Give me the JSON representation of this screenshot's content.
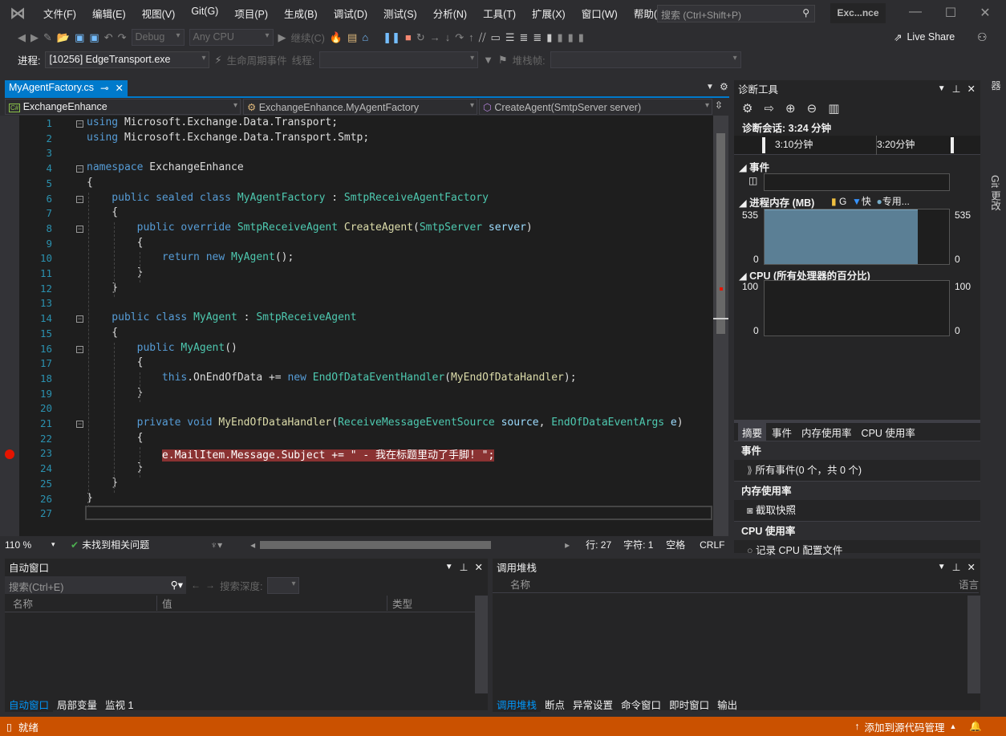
{
  "menu": {
    "items": [
      "文件(F)",
      "编辑(E)",
      "视图(V)",
      "Git(G)",
      "项目(P)",
      "生成(B)",
      "调试(D)",
      "测试(S)",
      "分析(N)",
      "工具(T)",
      "扩展(X)",
      "窗口(W)",
      "帮助(H)"
    ],
    "search_placeholder": "搜索 (Ctrl+Shift+P)",
    "window_title": "Exc...nce"
  },
  "toolbar": {
    "config": "Debug",
    "platform": "Any CPU",
    "continue": "继续(C)",
    "live_share": "Live Share"
  },
  "toolbar2": {
    "process_label": "进程:",
    "process": "[10256] EdgeTransport.exe",
    "lifecycle": "生命周期事件",
    "thread_label": "线程:",
    "stackframe_label": "堆栈帧:"
  },
  "editor": {
    "tab": "MyAgentFactory.cs",
    "nav_project": "ExchangeEnhance",
    "nav_class": "ExchangeEnhance.MyAgentFactory",
    "nav_member": "CreateAgent(SmtpServer server)",
    "lines": [
      [
        [
          "using",
          "k"
        ],
        [
          " Microsoft.Exchange.Data.Transport;",
          "pl"
        ]
      ],
      [
        [
          "using",
          "k"
        ],
        [
          " Microsoft.Exchange.Data.Transport.Smtp;",
          "pl"
        ]
      ],
      [],
      [
        [
          "namespace",
          "k"
        ],
        [
          " ExchangeEnhance",
          "pl"
        ]
      ],
      [
        [
          "{",
          "pl"
        ]
      ],
      [
        [
          "    public sealed class ",
          "k"
        ],
        [
          "MyAgentFactory",
          "t"
        ],
        [
          " : ",
          "pl"
        ],
        [
          "SmtpReceiveAgentFactory",
          "t"
        ]
      ],
      [
        [
          "    {",
          "pl"
        ]
      ],
      [
        [
          "        public override ",
          "k"
        ],
        [
          "SmtpReceiveAgent",
          "t"
        ],
        [
          " ",
          "pl"
        ],
        [
          "CreateAgent",
          "m"
        ],
        [
          "(",
          "pl"
        ],
        [
          "SmtpServer",
          "t"
        ],
        [
          " server",
          "p"
        ],
        [
          ")",
          "pl"
        ]
      ],
      [
        [
          "        {",
          "pl"
        ]
      ],
      [
        [
          "            return new ",
          "k"
        ],
        [
          "MyAgent",
          "t"
        ],
        [
          "();",
          "pl"
        ]
      ],
      [
        [
          "        }",
          "pl"
        ]
      ],
      [
        [
          "    }",
          "pl"
        ]
      ],
      [],
      [
        [
          "    public class ",
          "k"
        ],
        [
          "MyAgent",
          "t"
        ],
        [
          " : ",
          "pl"
        ],
        [
          "SmtpReceiveAgent",
          "t"
        ]
      ],
      [
        [
          "    {",
          "pl"
        ]
      ],
      [
        [
          "        public ",
          "k"
        ],
        [
          "MyAgent",
          "t"
        ],
        [
          "()",
          "pl"
        ]
      ],
      [
        [
          "        {",
          "pl"
        ]
      ],
      [
        [
          "            this",
          "k"
        ],
        [
          ".OnEndOfData += ",
          "pl"
        ],
        [
          "new ",
          "k"
        ],
        [
          "EndOfDataEventHandler",
          "t"
        ],
        [
          "(",
          "pl"
        ],
        [
          "MyEndOfDataHandler",
          "m"
        ],
        [
          ");",
          "pl"
        ]
      ],
      [
        [
          "        }",
          "pl"
        ]
      ],
      [],
      [
        [
          "        private void ",
          "k"
        ],
        [
          "MyEndOfDataHandler",
          "m"
        ],
        [
          "(",
          "pl"
        ],
        [
          "ReceiveMessageEventSource",
          "t"
        ],
        [
          " source",
          "p"
        ],
        [
          ", ",
          "pl"
        ],
        [
          "EndOfDataEventArgs",
          "t"
        ],
        [
          " e",
          "p"
        ],
        [
          ")",
          "pl"
        ]
      ],
      [
        [
          "        {",
          "pl"
        ]
      ],
      [
        [
          "            ",
          "pl"
        ],
        [
          "e.MailItem.Message.Subject += \" - 我在标题里动了手脚! \";",
          "bp"
        ]
      ],
      [
        [
          "        }",
          "pl"
        ]
      ],
      [
        [
          "    }",
          "pl"
        ]
      ],
      [
        [
          "}",
          "pl"
        ]
      ],
      []
    ],
    "folds": [
      1,
      4,
      6,
      8,
      14,
      16,
      21
    ],
    "breakpoint_line": 23,
    "zoom": "110 %",
    "issues": "未找到相关问题",
    "line": "行: 27",
    "char": "字符: 1",
    "spaces": "空格",
    "eol": "CRLF"
  },
  "diagnostics": {
    "title": "诊断工具",
    "session": "诊断会话: 3:24 分钟",
    "ticks": [
      "3:10分钟",
      "3:20分钟"
    ],
    "events_label": "事件",
    "memory_label": "进程内存 (MB)",
    "legend": [
      "G",
      "快",
      "专用..."
    ],
    "mem_max": "535",
    "mem_min": "0",
    "mem_fill": 1.0,
    "cpu_label": "CPU (所有处理器的百分比)",
    "cpu_max": "100",
    "cpu_min": "0",
    "tabs": [
      "摘要",
      "事件",
      "内存使用率",
      "CPU 使用率"
    ],
    "sec_events": "事件",
    "all_events": "所有事件(0 个，共 0 个)",
    "sec_memory": "内存使用率",
    "snapshot": "截取快照",
    "sec_cpu": "CPU 使用率",
    "record_cpu": "记录 CPU 配置文件",
    "colors": {
      "memory": "#5b7f95"
    }
  },
  "side_tabs": [
    "解决方案资源管理器",
    "Git 更改"
  ],
  "autos": {
    "title": "自动窗口",
    "search_placeholder": "搜索(Ctrl+E)",
    "depth_label": "搜索深度:",
    "cols": [
      "名称",
      "值",
      "类型"
    ],
    "tabs": [
      "自动窗口",
      "局部变量",
      "监视 1"
    ]
  },
  "callstack": {
    "title": "调用堆栈",
    "cols": [
      "名称",
      "语言"
    ],
    "tabs": [
      "调用堆栈",
      "断点",
      "异常设置",
      "命令窗口",
      "即时窗口",
      "输出"
    ]
  },
  "status": {
    "text": "就绪",
    "source_control": "添加到源代码管理",
    "color": "#ca5100"
  }
}
